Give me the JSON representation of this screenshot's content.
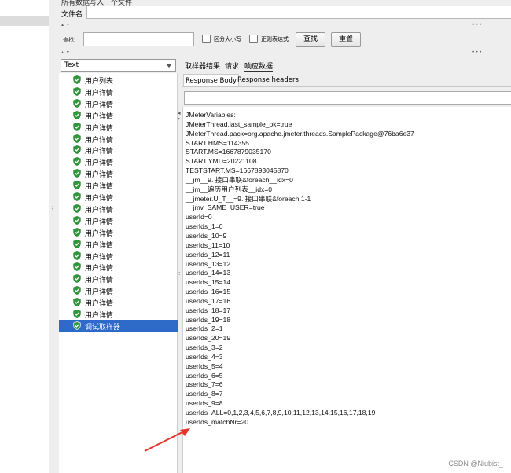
{
  "top": {
    "partial_label": "所有数据写入一个文件",
    "filename_label": "文件名",
    "filename_value": ""
  },
  "search": {
    "label": "查找:",
    "value": "",
    "case_label": "区分大小写",
    "regex_label": "正则表达式",
    "find_button": "查找",
    "reset_button": "重置"
  },
  "left_panel": {
    "combo_value": "Text",
    "items": [
      {
        "label": "用户列表"
      },
      {
        "label": "用户详情"
      },
      {
        "label": "用户详情"
      },
      {
        "label": "用户详情"
      },
      {
        "label": "用户详情"
      },
      {
        "label": "用户详情"
      },
      {
        "label": "用户详情"
      },
      {
        "label": "用户详情"
      },
      {
        "label": "用户详情"
      },
      {
        "label": "用户详情"
      },
      {
        "label": "用户详情"
      },
      {
        "label": "用户详情"
      },
      {
        "label": "用户详情"
      },
      {
        "label": "用户详情"
      },
      {
        "label": "用户详情"
      },
      {
        "label": "用户详情"
      },
      {
        "label": "用户详情"
      },
      {
        "label": "用户详情"
      },
      {
        "label": "用户详情"
      },
      {
        "label": "用户详情"
      },
      {
        "label": "用户详情"
      },
      {
        "label": "调试取样器"
      }
    ],
    "selected_index": 21
  },
  "tabs": [
    {
      "label": "取样器结果"
    },
    {
      "label": "请求"
    },
    {
      "label": "响应数据"
    }
  ],
  "subtabs": [
    {
      "label": "Response Body"
    },
    {
      "label": "Response headers"
    }
  ],
  "response_lines": [
    "JMeterVariables:",
    "JMeterThread.last_sample_ok=true",
    "JMeterThread.pack=org.apache.jmeter.threads.SamplePackage@76ba6e37",
    "START.HMS=114355",
    "START.MS=1667879035170",
    "START.YMD=20221108",
    "TESTSTART.MS=1667893045870",
    "__jm__9. 接口串联&foreach__idx=0",
    "__jm__遍历用户列表__idx=0",
    "__jmeter.U_T__=9. 接口串联&foreach 1-1",
    "__jmv_SAME_USER=true",
    "userId=0",
    "userIds_1=0",
    "userIds_10=9",
    "userIds_11=10",
    "userIds_12=11",
    "userIds_13=12",
    "userIds_14=13",
    "userIds_15=14",
    "userIds_16=15",
    "userIds_17=16",
    "userIds_18=17",
    "userIds_19=18",
    "userIds_2=1",
    "userIds_20=19",
    "userIds_3=2",
    "userIds_4=3",
    "userIds_5=4",
    "userIds_6=5",
    "userIds_7=6",
    "userIds_8=7",
    "userIds_9=8",
    "userIds_ALL=0,1,2,3,4,5,6,7,8,9,10,11,12,13,14,15,16,17,18,19",
    "userIds_matchNr=20"
  ],
  "watermark": "CSDN @Niubist_",
  "icons": {
    "item_icon": "shield-check-icon",
    "accent": "#2e6ac8",
    "success": "#2e9b3a",
    "annotation": "#e8332a"
  }
}
